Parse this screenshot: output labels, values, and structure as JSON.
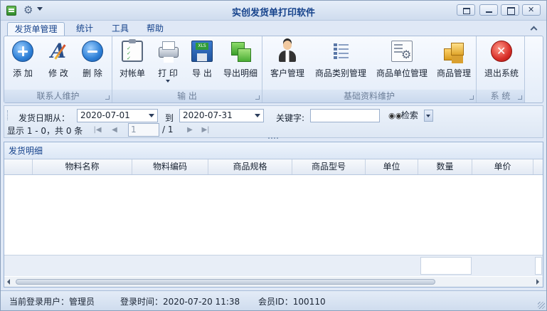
{
  "window": {
    "title": "实创发货单打印软件"
  },
  "tabs": [
    {
      "label": "发货单管理"
    },
    {
      "label": "统计"
    },
    {
      "label": "工具"
    },
    {
      "label": "帮助"
    }
  ],
  "ribbon": {
    "groups": {
      "contacts": "联系人维护",
      "output": "输 出",
      "basic": "基础资料维护",
      "system": "系 统"
    },
    "buttons": {
      "add": "添 加",
      "edit": "修 改",
      "delete": "删 除",
      "statement": "对帐单",
      "print": "打 印",
      "export": "导 出",
      "export_detail": "导出明细",
      "customer": "客户管理",
      "category": "商品类别管理",
      "unit": "商品单位管理",
      "product": "商品管理",
      "exit": "退出系统"
    }
  },
  "filter": {
    "date_from_label": "发货日期从：",
    "date_from": "2020-07-01",
    "to_label": "到",
    "date_to": "2020-07-31",
    "keyword_label": "关键字:",
    "keyword": "",
    "search_label": "检索"
  },
  "pager": {
    "display_text": "显示 1 - 0，共 0 条",
    "page": "1",
    "total": "/ 1"
  },
  "grid": {
    "title": "发货明细",
    "columns": [
      "物料名称",
      "物料编码",
      "商品规格",
      "商品型号",
      "单位",
      "数量",
      "单价"
    ],
    "rows": []
  },
  "status": {
    "user": "当前登录用户：管理员",
    "login_time": "登录时间：2020-07-20 11:38",
    "member_id": "会员ID：100110"
  },
  "icons": {
    "app": "app-icon",
    "gear": "gear-icon",
    "add": "plus-circle-icon",
    "edit": "font-edit-icon",
    "delete": "minus-circle-icon",
    "statement": "clipboard-check-icon",
    "print": "printer-icon",
    "export": "excel-save-icon",
    "export_detail": "export-sheets-icon",
    "customer": "person-icon",
    "category": "list-icon",
    "unit": "document-gear-icon",
    "product": "boxes-icon",
    "exit": "red-close-icon",
    "search": "binoculars-icon"
  }
}
